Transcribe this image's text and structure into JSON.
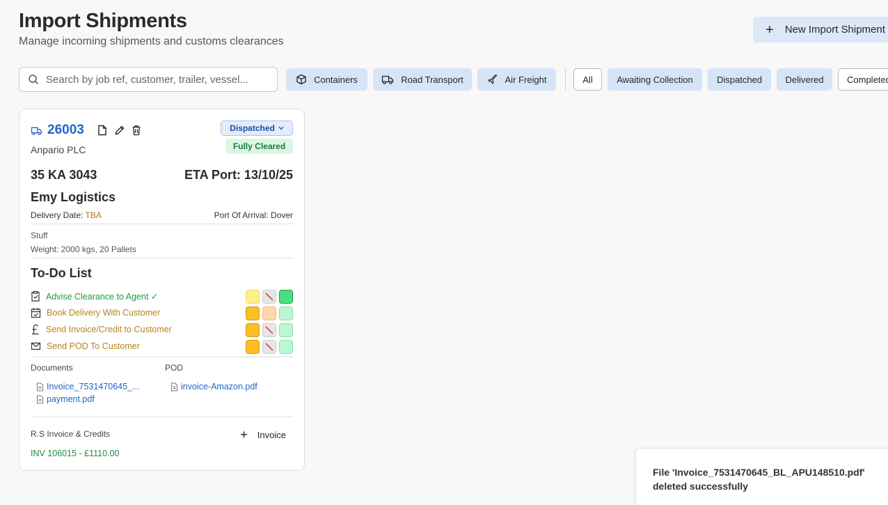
{
  "header": {
    "title": "Import Shipments",
    "subtitle": "Manage incoming shipments and customs clearances",
    "new_button": "New Import Shipment"
  },
  "search": {
    "placeholder": "Search by job ref, customer, trailer, vessel..."
  },
  "mode_filters": [
    {
      "label": "Containers",
      "icon": "container-box-icon"
    },
    {
      "label": "Road Transport",
      "icon": "truck-icon"
    },
    {
      "label": "Air Freight",
      "icon": "plane-icon"
    }
  ],
  "status_filters": [
    "All",
    "Awaiting Collection",
    "Dispatched",
    "Delivered",
    "Completed"
  ],
  "card": {
    "job_ref": "26003",
    "customer": "Anpario PLC",
    "status": "Dispatched",
    "clearance": "Fully Cleared",
    "trailer": "35 KA 3043",
    "eta": "ETA Port: 13/10/25",
    "haulier": "Emy Logistics",
    "delivery_date_label": "Delivery Date:",
    "delivery_date_value": "TBA",
    "port_of_arrival": "Port Of Arrival: Dover",
    "goods_description": "Stuff",
    "weight": "Weight: 2000 kgs, 20 Pallets",
    "todo_title": "To-Do List",
    "todos": [
      {
        "label": "Advise Clearance to Agent ✓",
        "icon": "clipboard-check-icon",
        "color": "#1d9a45"
      },
      {
        "label": "Book Delivery With Customer",
        "icon": "calendar-check-icon",
        "color": "#b8841a"
      },
      {
        "label": "Send Invoice/Credit to Customer",
        "icon": "pound-icon",
        "color": "#b8841a"
      },
      {
        "label": "Send POD To Customer",
        "icon": "mail-icon",
        "color": "#b8841a"
      }
    ],
    "documents_label": "Documents",
    "documents": [
      "Invoice_7531470645_...",
      "payment.pdf"
    ],
    "pod_label": "POD",
    "pod_documents": [
      "invoice-Amazon.pdf"
    ],
    "invoices_label": "R.S Invoice & Credits",
    "add_invoice": "Invoice",
    "invoice_entry": "INV 106015 - £1110.00"
  },
  "toast": {
    "message": "File 'Invoice_7531470645_BL_APU148510.pdf' deleted successfully"
  },
  "colors": {
    "accent": "#2167c6",
    "chip_bg": "#d6e4f7",
    "success": "#1d9a45",
    "warning": "#b8841a"
  }
}
